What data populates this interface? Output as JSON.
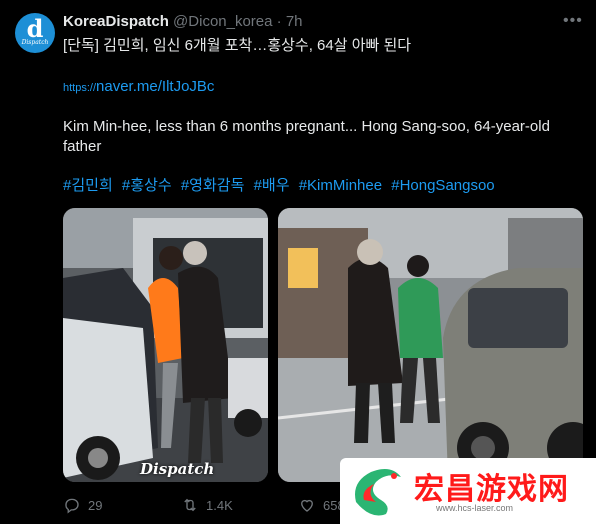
{
  "account": {
    "avatar_letter": "d",
    "avatar_sub": "Dispatch",
    "name": "KoreaDispatch",
    "handle": "@Dicon_korea",
    "dot": "·",
    "time": "7h",
    "more_icon": "more-dots-icon"
  },
  "tweet": {
    "headline": "[단독] 김민희, 임신 6개월 포착…홍상수, 64살 아빠 된다",
    "link_prefix": "https://",
    "link_rest": "naver.me/IltJoJBc",
    "english_line1": "Kim Min-hee, less than 6 months pregnant... Hong Sang-soo, 64-year-old",
    "english_line2": "father",
    "hashtags": [
      "#김민희",
      "#홍상수",
      "#영화감독",
      "#배우",
      "#KimMinhee",
      "#HongSangsoo"
    ]
  },
  "media": {
    "watermark": "Dispatch"
  },
  "actions": {
    "reply_count": "29",
    "retweet_count": "1.4K",
    "like_count": "658"
  },
  "overlay": {
    "title": "宏昌游戏网",
    "url": "www.hcs-laser.com"
  },
  "colors": {
    "background": "#000000",
    "link": "#1d9bf0",
    "muted": "#71767b",
    "text": "#e7e9ea",
    "avatar": "#1d8fd6",
    "promo_red": "#ff1a1a",
    "promo_green": "#2bb573"
  }
}
